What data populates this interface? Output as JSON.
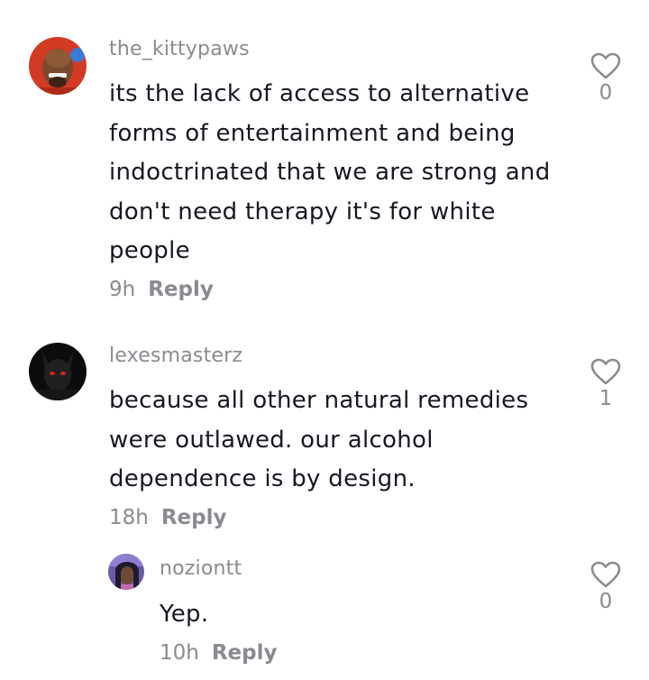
{
  "comments": [
    {
      "username": "the_kittypaws",
      "text": "its the lack of access to alternative forms of entertainment and being indoctrinated that we are strong and don't need therapy it's for white people",
      "lines": [
        "its the lack of access to alternative",
        "forms of entertainment and being",
        "indoctrinated that we are strong and",
        "don't need therapy it's for white",
        "people"
      ],
      "time": "9h",
      "reply_label": "Reply",
      "like_count": "0"
    },
    {
      "username": "lexesmasterz",
      "lines": [
        "because all other natural remedies",
        "were outlawed. our alcohol",
        "dependence is by design."
      ],
      "time": "18h",
      "reply_label": "Reply",
      "like_count": "1"
    },
    {
      "username": "noziontt",
      "lines": [
        "Yep."
      ],
      "time": "10h",
      "reply_label": "Reply",
      "like_count": "0"
    }
  ],
  "icons": {
    "like": "heart-outline-icon"
  },
  "colors": {
    "text": "#161823",
    "secondary": "#8a8b91",
    "background": "#ffffff"
  }
}
